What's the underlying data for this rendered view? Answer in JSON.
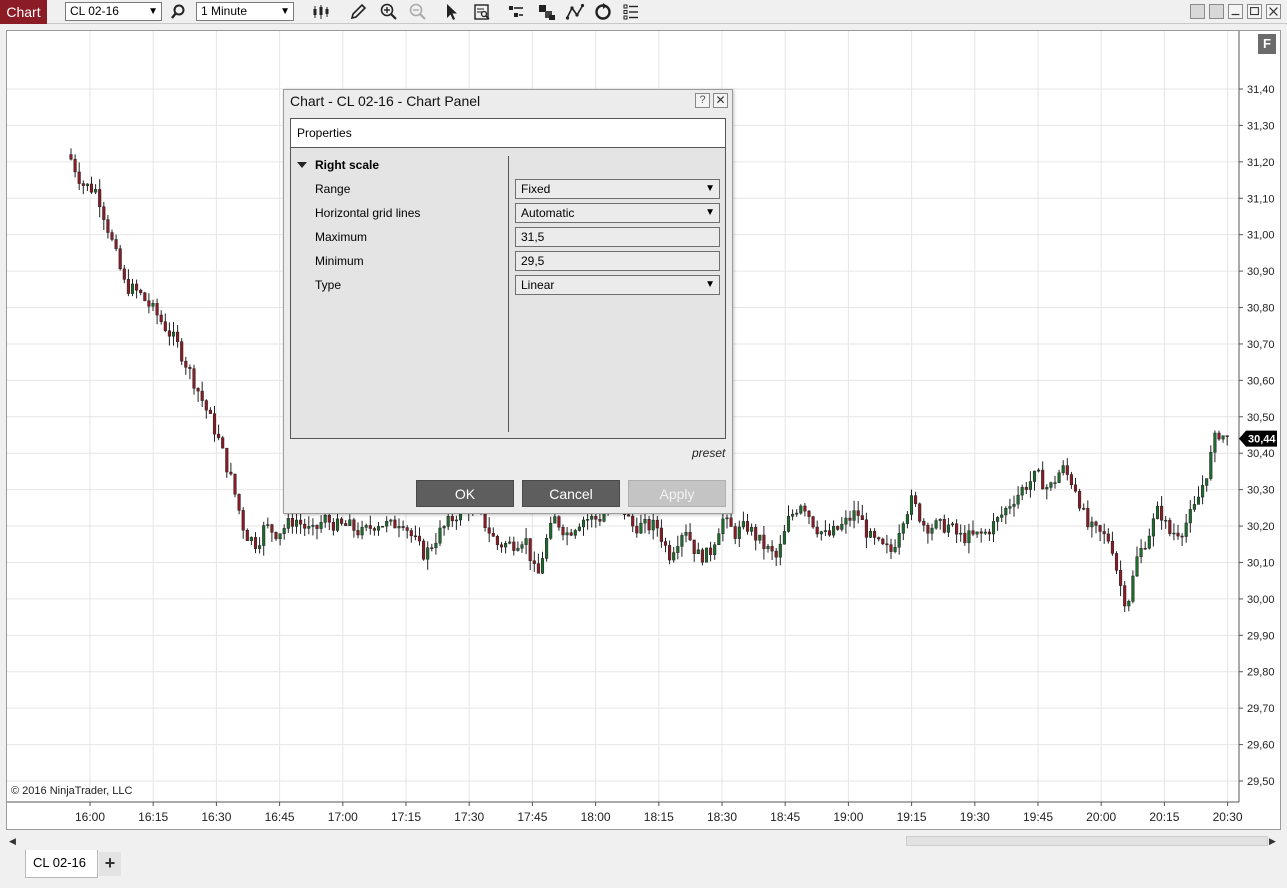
{
  "toolbar": {
    "app_label": "Chart",
    "instrument": "CL 02-16",
    "interval": "1 Minute",
    "icons": [
      "search-icon",
      "bar-style-icon",
      "pencil-icon",
      "zoom-in-icon",
      "zoom-out-icon",
      "pointer-icon",
      "data-box-icon",
      "strategies-icon",
      "indicators-icon",
      "drawing-tools-icon",
      "refresh-icon",
      "properties-list-icon"
    ]
  },
  "chart": {
    "f_label": "F",
    "copyright": "© 2016 NinjaTrader, LLC",
    "last_price": "30,44",
    "y_ticks": [
      "31,40",
      "31,30",
      "31,20",
      "31,10",
      "31,00",
      "30,90",
      "30,80",
      "30,70",
      "30,60",
      "30,50",
      "30,40",
      "30,30",
      "30,20",
      "30,10",
      "30,00",
      "29,90",
      "29,80",
      "29,70",
      "29,60",
      "29,50"
    ],
    "x_ticks": [
      "16:00",
      "16:15",
      "16:30",
      "16:45",
      "17:00",
      "17:15",
      "17:30",
      "17:45",
      "18:00",
      "18:15",
      "18:30",
      "18:45",
      "19:00",
      "19:15",
      "19:30",
      "19:45",
      "20:00",
      "20:15",
      "20:30"
    ],
    "colors": {
      "up": "#1e6b2e",
      "down": "#8b1b24",
      "grid": "#e6e6e6",
      "price_marker": "#000000"
    }
  },
  "dialog": {
    "title": "Chart - CL 02-16 - Chart Panel",
    "help": "?",
    "close": "✕",
    "properties_header": "Properties",
    "section": "Right scale",
    "properties": [
      {
        "label": "Range",
        "value": "Fixed",
        "dropdown": true
      },
      {
        "label": "Horizontal grid lines",
        "value": "Automatic",
        "dropdown": true
      },
      {
        "label": "Maximum",
        "value": "31,5",
        "dropdown": false
      },
      {
        "label": "Minimum",
        "value": "29,5",
        "dropdown": false
      },
      {
        "label": "Type",
        "value": "Linear",
        "dropdown": true
      }
    ],
    "preset": "preset",
    "buttons": {
      "ok": "OK",
      "cancel": "Cancel",
      "apply": "Apply"
    }
  },
  "tabs": {
    "active": "CL 02-16",
    "add": "+"
  }
}
